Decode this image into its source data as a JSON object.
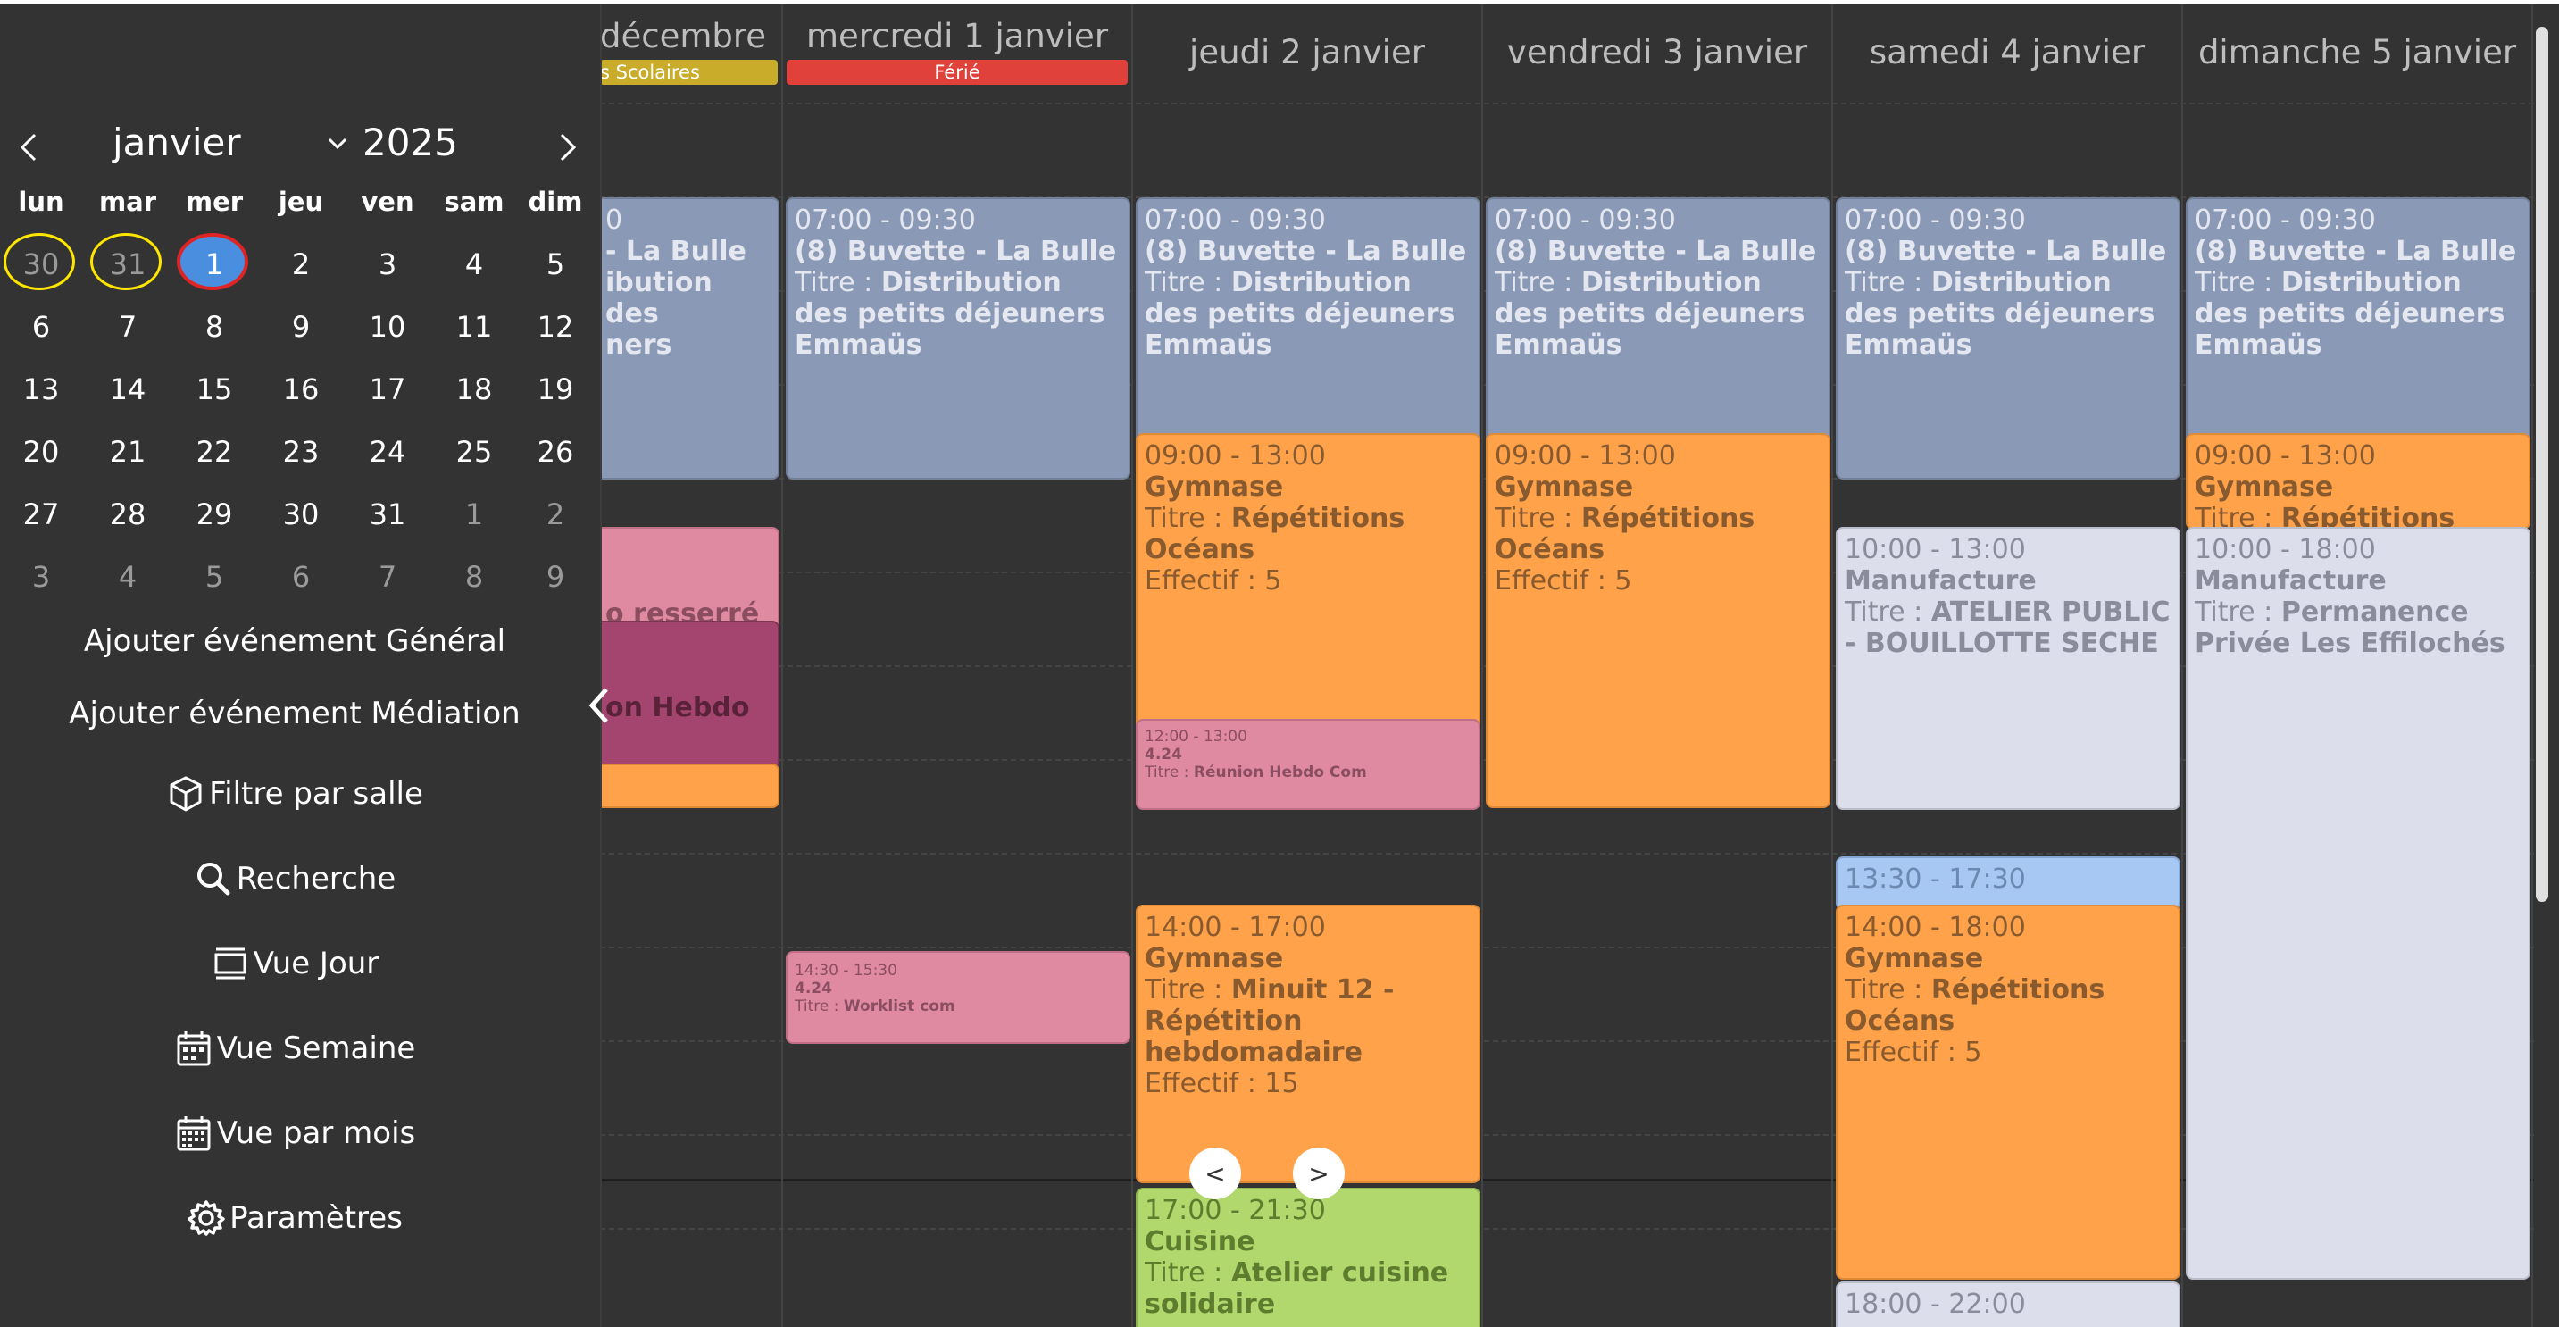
{
  "sidebar": {
    "month": "janvier",
    "year": "2025",
    "weekdays": [
      "lun",
      "mar",
      "mer",
      "jeu",
      "ven",
      "sam",
      "dim"
    ],
    "weeks": [
      [
        "30",
        "31",
        "1",
        "2",
        "3",
        "4",
        "5"
      ],
      [
        "6",
        "7",
        "8",
        "9",
        "10",
        "11",
        "12"
      ],
      [
        "13",
        "14",
        "15",
        "16",
        "17",
        "18",
        "19"
      ],
      [
        "20",
        "21",
        "22",
        "23",
        "24",
        "25",
        "26"
      ],
      [
        "27",
        "28",
        "29",
        "30",
        "31",
        "1",
        "2"
      ],
      [
        "3",
        "4",
        "5",
        "6",
        "7",
        "8",
        "9"
      ]
    ],
    "buttons": {
      "add_general": "Ajouter événement Général",
      "add_mediation": "Ajouter événement Médiation",
      "filter_room": "Filtre par salle",
      "search": "Recherche",
      "day_view": "Vue Jour",
      "week_view": "Vue Semaine",
      "month_view": "Vue par mois",
      "settings": "Paramètres"
    }
  },
  "columns": [
    {
      "label": "décembre",
      "badge": "s Scolaires",
      "badge_color": "#c9ac2a"
    },
    {
      "label": "mercredi 1 janvier",
      "badge": "Férié",
      "badge_color": "#e0413a"
    },
    {
      "label": "jeudi 2 janvier"
    },
    {
      "label": "vendredi 3 janvier"
    },
    {
      "label": "samedi 4 janvier"
    },
    {
      "label": "dimanche 5 janvier"
    }
  ],
  "events": {
    "c0_buv": {
      "l1": "0",
      "l2": "- La Bulle",
      "l3": "ibution des",
      "l4": "ners"
    },
    "c0_pink": {
      "l1": "o resserré"
    },
    "c0_mauve": {
      "l1": "on Hebdo"
    },
    "buv": {
      "time": "07:00 - 09:30",
      "place": "(8) Buvette - La Bulle",
      "title_label": "Titre :",
      "title": "Distribution des petits déjeuners Emmaüs"
    },
    "c1_worklist": {
      "time": "14:30 - 15:30",
      "place": "4.24",
      "title_label": "Titre :",
      "title": "Worklist com"
    },
    "gym_morning": {
      "time": "09:00 - 13:00",
      "place": "Gymnase",
      "title_label": "Titre :",
      "title": "Répétitions Océans",
      "count": "Effectif : 5"
    },
    "c2_hebdo": {
      "time": "12:00 - 13:00",
      "place": "4.24",
      "title_label": "Titre :",
      "title": "Réunion Hebdo Com"
    },
    "c2_minuit": {
      "time": "14:00 - 17:00",
      "place": "Gymnase",
      "title_label": "Titre :",
      "title": "Minuit 12 - Répétition hebdomadaire",
      "count": "Effectif : 15"
    },
    "c2_cuisine": {
      "time": "17:00 - 21:30",
      "place": "Cuisine",
      "title_label": "Titre :",
      "title": "Atelier cuisine solidaire"
    },
    "c4_manuf": {
      "time": "10:00 - 13:00",
      "place": "Manufacture",
      "title_label": "Titre :",
      "title": "ATELIER PUBLIC - BOUILLOTTE SECHE"
    },
    "c4_blue": {
      "time": "13:30 - 17:30"
    },
    "c4_gym": {
      "time": "14:00 - 18:00",
      "place": "Gymnase",
      "title_label": "Titre :",
      "title": "Répétitions Océans",
      "count": "Effectif : 5"
    },
    "c4_evening": {
      "time": "18:00 - 22:00"
    },
    "c5_gym": {
      "time": "09:00 - 13:00",
      "place": "Gymnase",
      "title_label": "Titre :",
      "title": "Répétitions"
    },
    "c5_manuf": {
      "time": "10:00 - 18:00",
      "place": "Manufacture",
      "title_label": "Titre :",
      "title": "Permanence Privée Les Effilochés"
    }
  },
  "scroll": {
    "prev": "<",
    "next": ">"
  }
}
